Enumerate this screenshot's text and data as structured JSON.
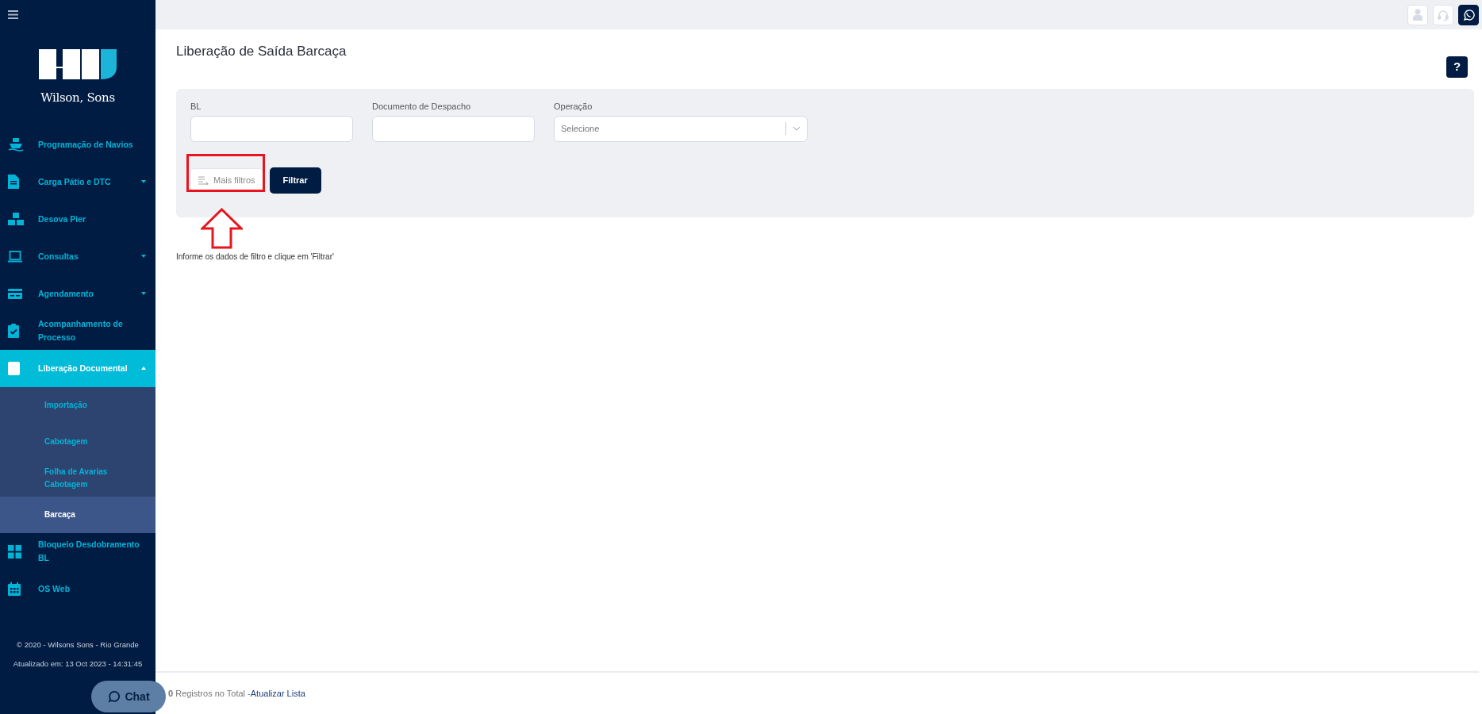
{
  "sidebar": {
    "logo_text": "Wilson, Sons",
    "items": [
      {
        "label": "Programação de Navios",
        "has_submenu": false,
        "selected": false
      },
      {
        "label": "Carga Pátio e DTC",
        "has_submenu": true,
        "expanded": false,
        "selected": false
      },
      {
        "label": "Desova Pier",
        "has_submenu": false,
        "selected": false
      },
      {
        "label": "Consultas",
        "has_submenu": true,
        "expanded": false,
        "selected": false
      },
      {
        "label": "Agendamento",
        "has_submenu": true,
        "expanded": false,
        "selected": false
      },
      {
        "label": "Acompanhamento de Processo",
        "has_submenu": false,
        "selected": false
      },
      {
        "label": "Liberação Documental",
        "has_submenu": true,
        "expanded": true,
        "selected": true,
        "children": [
          {
            "label": "Importação",
            "selected": false
          },
          {
            "label": "Cabotagem",
            "selected": false
          },
          {
            "label": "Folha de Avarias Cabotagem",
            "selected": false
          },
          {
            "label": "Barcaça",
            "selected": true
          }
        ]
      },
      {
        "label": "Bloqueio Desdobramento BL",
        "has_submenu": false,
        "selected": false
      },
      {
        "label": "OS Web",
        "has_submenu": false,
        "selected": false
      }
    ],
    "footer": [
      "© 2020 - Wilsons Sons - Rio Grande",
      "Atualizado em: 13 Oct 2023 - 14:31:45"
    ]
  },
  "chat_button": {
    "label": "Chat"
  },
  "page": {
    "title": "Liberação de Saída Barcaça",
    "help_button": "?",
    "filters": [
      {
        "label": "BL",
        "kind": "text"
      },
      {
        "label": "Documento de Despacho",
        "kind": "text"
      },
      {
        "label": "Operação",
        "kind": "select",
        "value": "Selecione"
      }
    ],
    "buttons": [
      {
        "label": "Mais filtros",
        "kind": "secondary"
      },
      {
        "label": "Filtrar",
        "kind": "primary"
      }
    ],
    "hint": "Informe os dados de filtro e clique em 'Filtrar'"
  },
  "status_bar": {
    "count_text": "**0** Registros no Total -",
    "link": "Atualizar Lista"
  }
}
